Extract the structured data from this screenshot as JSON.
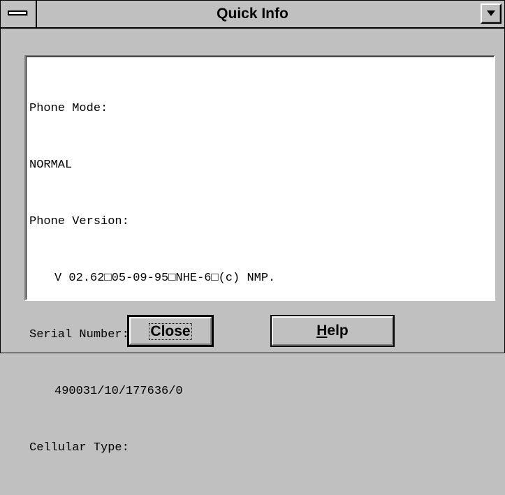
{
  "window": {
    "title": "Quick Info"
  },
  "titlebar": {
    "system_menu_icon": "system-menu-icon",
    "dropdown_icon": "chevron-down-icon"
  },
  "info": {
    "lines": [
      "Phone Mode:",
      "NORMAL",
      "Phone Version:",
      "V 02.62□05-09-95□NHE-6□(c) NMP.",
      "Serial Number:",
      "490031/10/177636/0",
      "Cellular Type:"
    ]
  },
  "buttons": {
    "close_label": "Close",
    "help_mnemonic": "H",
    "help_rest": "elp"
  }
}
